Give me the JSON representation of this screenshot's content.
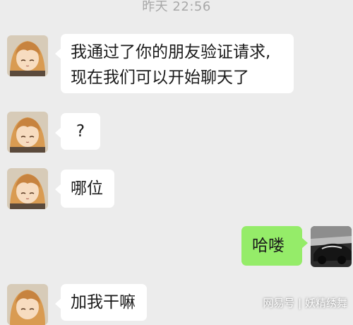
{
  "timestamp": "昨天 22:56",
  "messages": [
    {
      "side": "left",
      "lines": [
        "我通过了你的朋友验证请求,",
        "现在我们可以开始聊天了"
      ]
    },
    {
      "side": "left",
      "lines": [
        "?"
      ]
    },
    {
      "side": "left",
      "lines": [
        "哪位"
      ]
    },
    {
      "side": "right",
      "lines": [
        "哈喽"
      ]
    },
    {
      "side": "left",
      "lines": [
        "加我干嘛"
      ]
    }
  ],
  "watermark": "网易号 | 妖精绣舞",
  "colors": {
    "background": "#ececec",
    "incoming_bubble": "#ffffff",
    "outgoing_bubble": "#95ec69",
    "timestamp": "#a8a8a8"
  },
  "icons": {
    "contact_avatar": "anime-girl-avatar",
    "own_avatar": "car-photo-avatar"
  }
}
